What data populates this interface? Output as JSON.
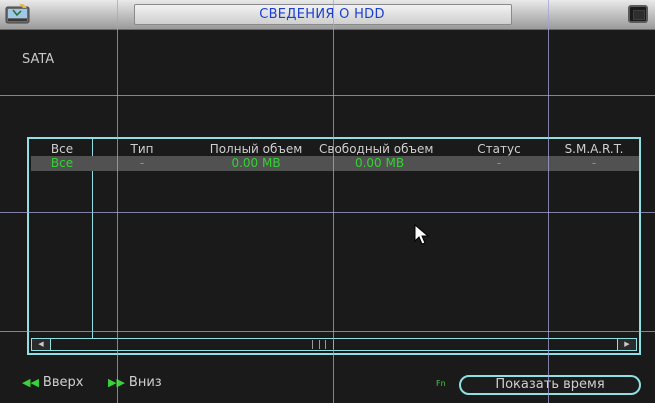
{
  "window": {
    "title": "СВЕДЕНИЯ О HDD",
    "icon": "hdd-icon"
  },
  "sata_label": "SATA",
  "table": {
    "headers": [
      "Все",
      "Тип",
      "Полный объем",
      "Свободный объем",
      "Статус",
      "S.M.A.R.T."
    ],
    "rows": [
      [
        "Все",
        "-",
        "0.00 MB",
        "0.00 MB",
        "-",
        "-"
      ]
    ]
  },
  "footer": {
    "up_label": "Вверх",
    "down_label": "Вниз",
    "fn_label": "Fn",
    "show_time_label": "Показать время"
  },
  "colors": {
    "accent": "#8fe0e3",
    "title_text": "#1a3fd0",
    "value_text": "#34d134",
    "selected_row": "#515151"
  }
}
